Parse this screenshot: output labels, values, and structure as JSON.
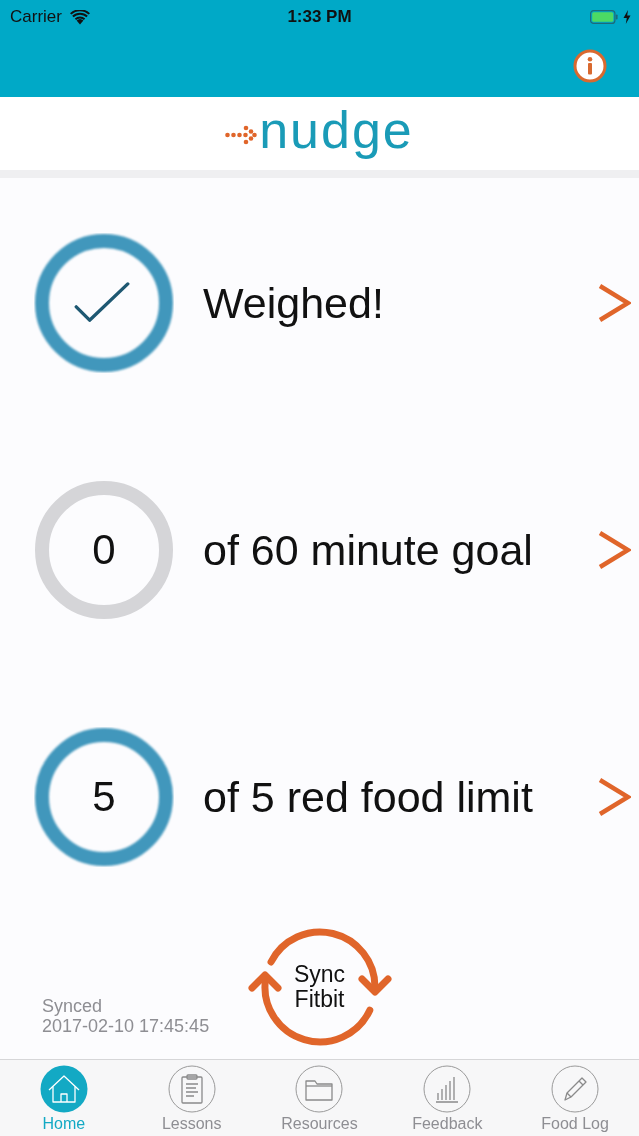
{
  "status_bar": {
    "carrier": "Carrier",
    "time": "1:33 PM"
  },
  "logo": {
    "text": "nudge"
  },
  "goals": [
    {
      "kind": "check",
      "label": "Weighed!",
      "complete": true
    },
    {
      "kind": "count",
      "value": "0",
      "label": "of 60 minute goal",
      "complete": false
    },
    {
      "kind": "count",
      "value": "5",
      "label": "of 5 red food limit",
      "complete": true
    }
  ],
  "sync": {
    "status": "Synced",
    "timestamp": "2017-02-10 17:45:45",
    "button": "Sync Fitbit"
  },
  "tabs": [
    {
      "label": "Home",
      "selected": true
    },
    {
      "label": "Lessons",
      "selected": false
    },
    {
      "label": "Resources",
      "selected": false
    },
    {
      "label": "Feedback",
      "selected": false
    },
    {
      "label": "Food Log",
      "selected": false
    }
  ]
}
